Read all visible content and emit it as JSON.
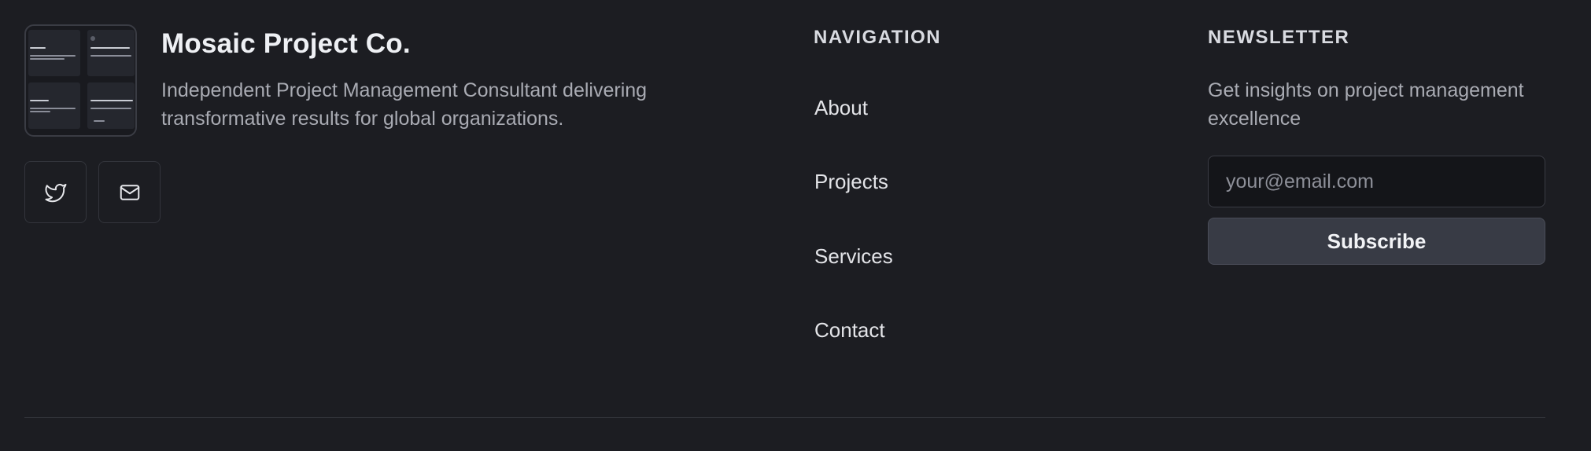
{
  "brand": {
    "name": "Mosaic Project Co.",
    "description": "Independent Project Management Consultant delivering transformative results for global organizations.",
    "logo_icon": "mosaic-grid-thumbnail"
  },
  "social": [
    {
      "name": "twitter",
      "icon": "twitter-icon"
    },
    {
      "name": "email",
      "icon": "mail-icon"
    }
  ],
  "navigation": {
    "heading": "NAVIGATION",
    "links": [
      "About",
      "Projects",
      "Services",
      "Contact"
    ]
  },
  "newsletter": {
    "heading": "NEWSLETTER",
    "description": "Get insights on project management excellence",
    "email_placeholder": "your@email.com",
    "email_value": "",
    "subscribe_label": "Subscribe"
  },
  "colors": {
    "background": "#1c1d22",
    "button": "#383b45",
    "input_bg": "#141519",
    "border": "#33353c"
  }
}
